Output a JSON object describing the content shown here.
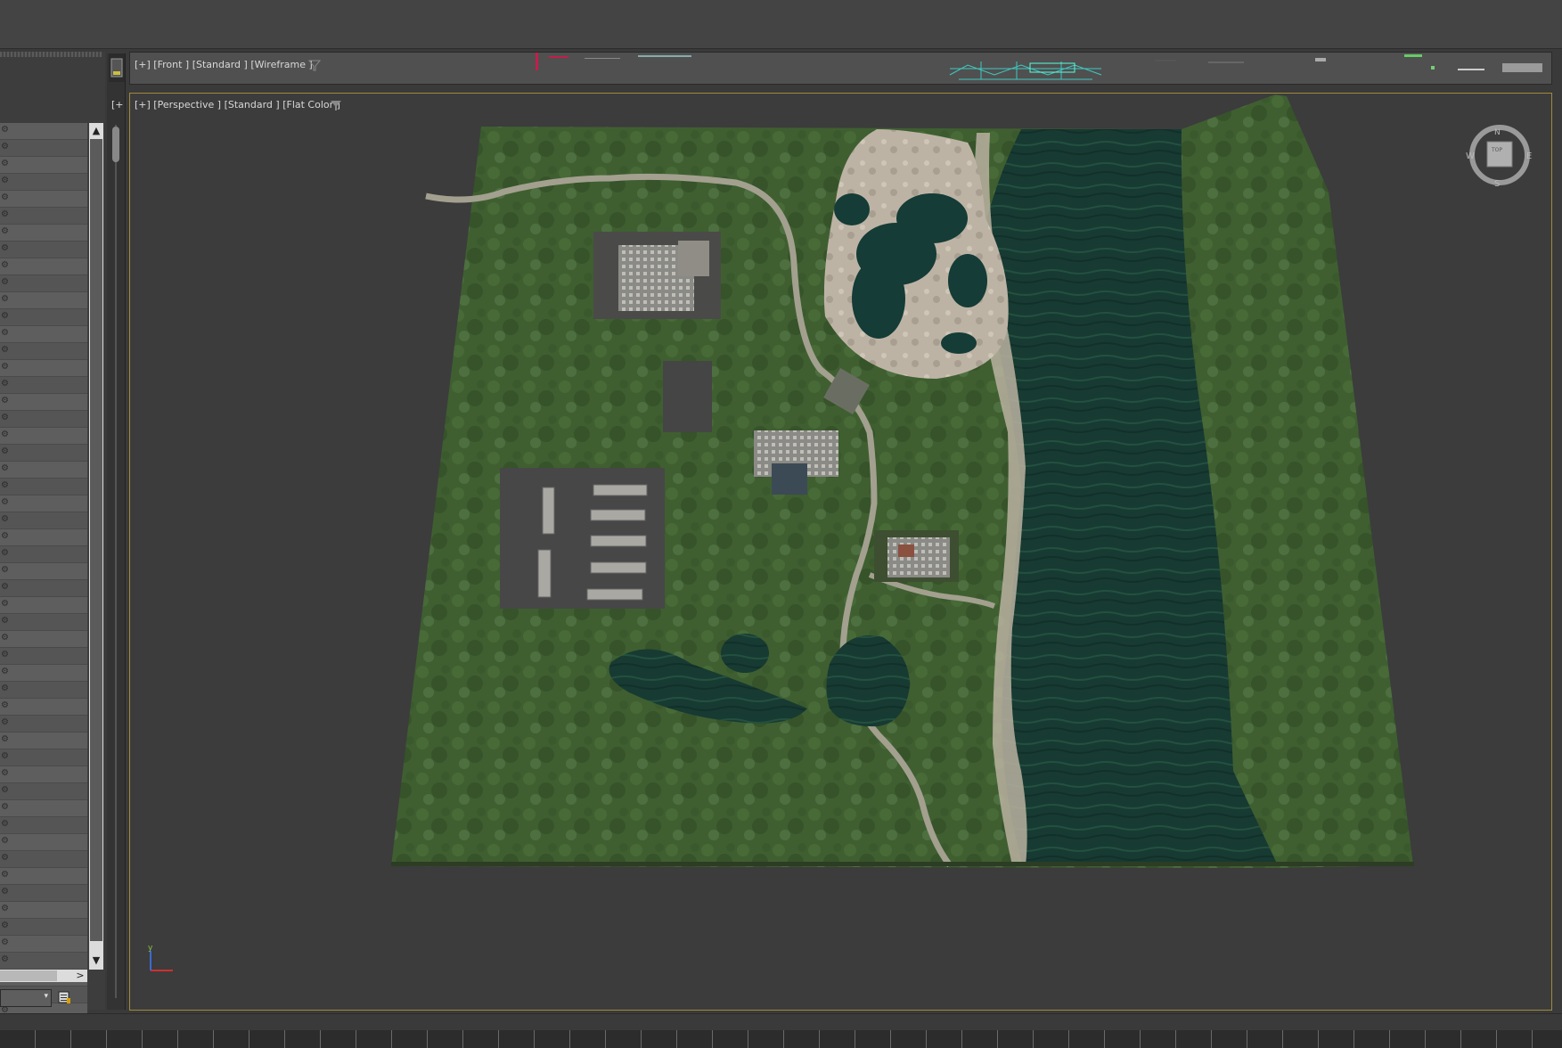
{
  "viewports": {
    "front_label": "[+] [Front ] [Standard ] [Wireframe ]",
    "perspective_label": "[+] [Perspective ] [Standard ] [Flat Color ]",
    "side_corner_label": "[+"
  },
  "nav_cube": {
    "north": "N",
    "south": "S",
    "east": "E",
    "west": "W",
    "face": "TOP"
  },
  "axis_gizmo": {
    "y_label": "y"
  },
  "scene_explorer": {
    "row_glyph": "⚙",
    "row_count": 53,
    "scroll_up": "▲",
    "scroll_down": "▼",
    "scroll_right": ">",
    "dropdown_arrow": "▾"
  },
  "colors": {
    "grass": "#3f5f31",
    "water": "#173a32",
    "rock": "#bdb3a5",
    "road": "#a3a08f",
    "viewport_border": "#a08a3a"
  },
  "icons": {
    "filter": "filter-icon",
    "compass": "view-cube-icon",
    "axis": "axis-tripod-icon"
  }
}
